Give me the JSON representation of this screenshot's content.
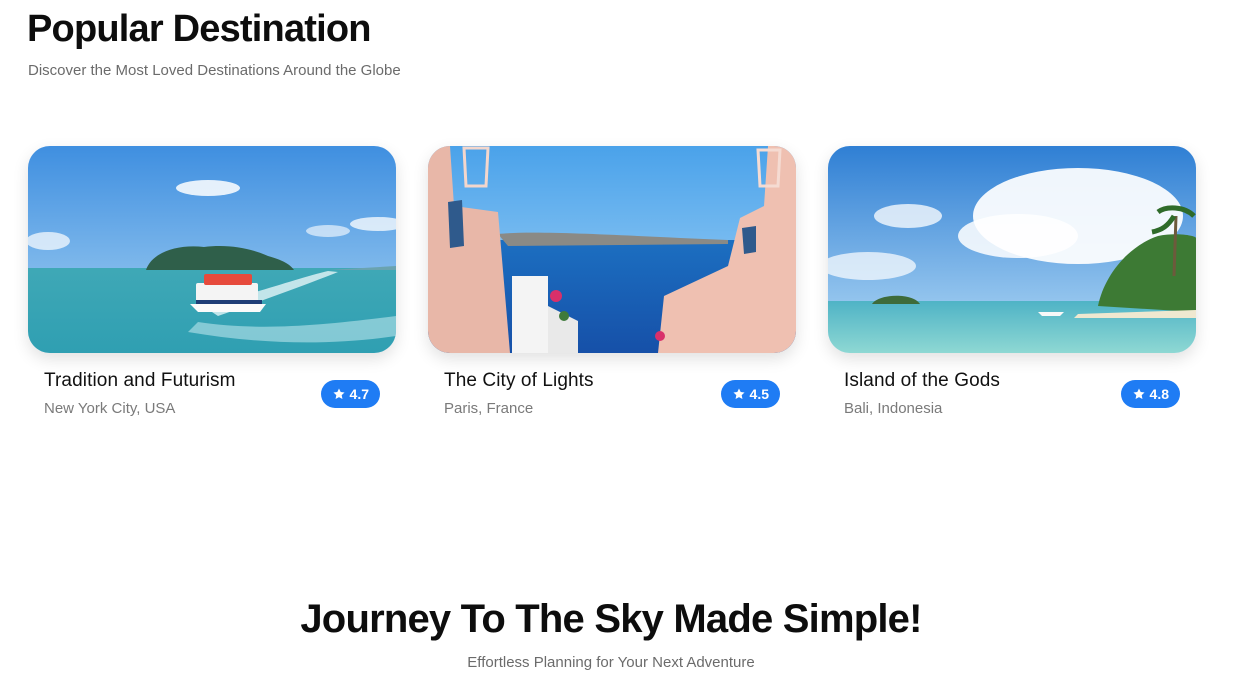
{
  "popular": {
    "title": "Popular Destination",
    "subtitle": "Discover the Most Loved Destinations Around the Globe"
  },
  "destinations": [
    {
      "title": "Tradition and Futurism",
      "location": "New York City, USA",
      "rating": "4.7",
      "image": "boat-island-sea-photo"
    },
    {
      "title": "The City of Lights",
      "location": "Paris, France",
      "rating": "4.5",
      "image": "santorini-sea-view-photo"
    },
    {
      "title": "Island of the Gods",
      "location": "Bali, Indonesia",
      "rating": "4.8",
      "image": "tropical-beach-photo"
    }
  ],
  "journey": {
    "title": "Journey To The Sky Made Simple!",
    "subtitle": "Effortless Planning for Your Next Adventure"
  },
  "colors": {
    "accent": "#1f7cf4",
    "heading": "#0d0d0d",
    "muted": "#6b6b6b"
  },
  "icons": {
    "rating": "star-icon"
  }
}
